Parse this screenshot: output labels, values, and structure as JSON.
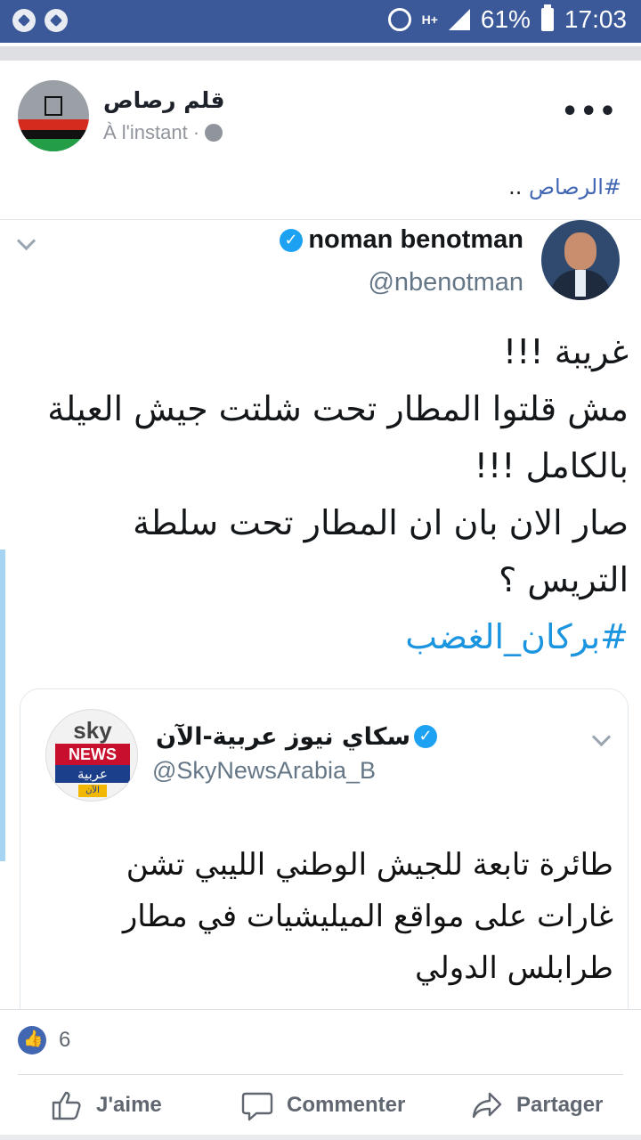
{
  "status_bar": {
    "network": "H+",
    "battery": "61%",
    "time": "17:03"
  },
  "post": {
    "author": "قلم رصاص",
    "timestamp": "À l'instant",
    "separator": "·",
    "text_hashtag": "#الرصاص",
    "text_suffix": " .."
  },
  "tweet": {
    "name": "noman benotman",
    "handle": "@nbenotman",
    "lines": [
      "غريبة !!!",
      "مش قلتوا المطار تحت شلتت جيش العيلة",
      "بالكامل !!!",
      "صار الان بان ان المطار تحت سلطة",
      "التريس ؟"
    ],
    "hashtag": "#بركان_الغضب"
  },
  "quoted": {
    "name": "سكاي نيوز عربية-الآن",
    "handle": "@SkyNewsArabia_B",
    "logo": {
      "top": "sky",
      "middle": "NEWS",
      "bottom": "عربية",
      "badge": "الآن"
    },
    "lines": [
      "طائرة تابعة للجيش الوطني الليبي تشن",
      "غارات على مواقع الميليشيات في مطار",
      "طرابلس الدولي"
    ]
  },
  "reactions": {
    "like_count": "6"
  },
  "actions": {
    "like_label": "J'aime",
    "comment_label": "Commenter",
    "share_label": "Partager"
  },
  "colors": {
    "facebook_blue": "#3b5998",
    "link_blue": "#4267b2",
    "twitter_blue": "#1da1f2"
  }
}
